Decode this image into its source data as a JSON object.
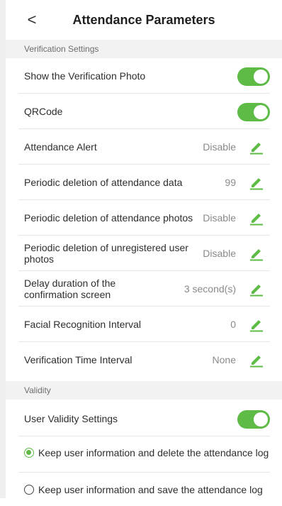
{
  "header": {
    "back_label": "<",
    "title": "Attendance Parameters"
  },
  "sections": {
    "verification": "Verification Settings",
    "validity": "Validity"
  },
  "rows": {
    "show_photo": {
      "label": "Show the Verification Photo",
      "enabled": true
    },
    "qrcode": {
      "label": "QRCode",
      "enabled": true
    },
    "attendance_alert": {
      "label": "Attendance Alert",
      "value": "Disable"
    },
    "periodic_data": {
      "label": "Periodic deletion of attendance data",
      "value": "99"
    },
    "periodic_photos": {
      "label": "Periodic deletion of attendance photos",
      "value": "Disable"
    },
    "periodic_unregistered": {
      "label": "Periodic deletion of unregistered user photos",
      "value": "Disable"
    },
    "delay_duration": {
      "label": "Delay duration of the confirmation screen",
      "value": "3 second(s)"
    },
    "facial_interval": {
      "label": "Facial Recognition Interval",
      "value": "0"
    },
    "verification_interval": {
      "label": "Verification Time Interval",
      "value": "None"
    },
    "user_validity": {
      "label": "User Validity Settings",
      "enabled": true
    }
  },
  "options": {
    "delete_log": {
      "label": "Keep user information and delete the attendance log",
      "selected": true
    },
    "save_log": {
      "label": "Keep user information and save the attendance log",
      "selected": false
    }
  },
  "colors": {
    "accent": "#5dbb46",
    "section_bg": "#f2f2f2"
  },
  "icons": {
    "edit": "pencil-icon",
    "back": "chevron-left-icon"
  }
}
